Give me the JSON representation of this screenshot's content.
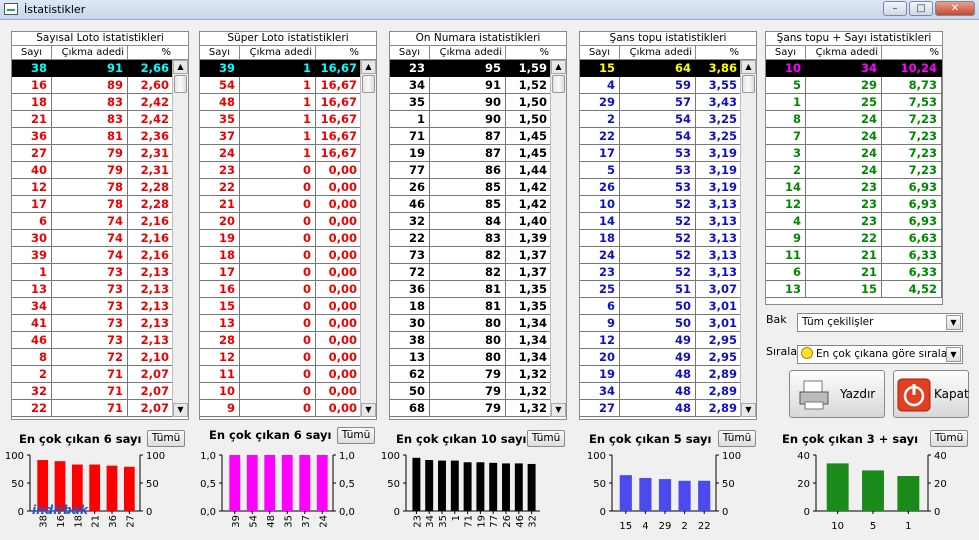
{
  "window": {
    "title": "İstatistikler"
  },
  "panels": [
    {
      "id": "sayisal",
      "title": "Sayısal Loto istatistikleri",
      "headers": [
        "Sayı",
        "Çıkma adedi",
        "%"
      ],
      "text_color": "#ee0000",
      "sel_color": "#00ffff",
      "rows": [
        [
          "38",
          "91",
          "2,66"
        ],
        [
          "16",
          "89",
          "2,60"
        ],
        [
          "18",
          "83",
          "2,42"
        ],
        [
          "21",
          "83",
          "2,42"
        ],
        [
          "36",
          "81",
          "2,36"
        ],
        [
          "27",
          "79",
          "2,31"
        ],
        [
          "40",
          "79",
          "2,31"
        ],
        [
          "12",
          "78",
          "2,28"
        ],
        [
          "17",
          "78",
          "2,28"
        ],
        [
          "6",
          "74",
          "2,16"
        ],
        [
          "30",
          "74",
          "2,16"
        ],
        [
          "39",
          "74",
          "2,16"
        ],
        [
          "1",
          "73",
          "2,13"
        ],
        [
          "13",
          "73",
          "2,13"
        ],
        [
          "34",
          "73",
          "2,13"
        ],
        [
          "41",
          "73",
          "2,13"
        ],
        [
          "46",
          "73",
          "2,13"
        ],
        [
          "8",
          "72",
          "2,10"
        ],
        [
          "2",
          "71",
          "2,07"
        ],
        [
          "32",
          "71",
          "2,07"
        ],
        [
          "22",
          "71",
          "2,07"
        ]
      ]
    },
    {
      "id": "super",
      "title": "Süper Loto istatistikleri",
      "headers": [
        "Sayı",
        "Çıkma adedi",
        "%"
      ],
      "text_color": "#ee0000",
      "sel_color": "#00ffff",
      "rows": [
        [
          "39",
          "1",
          "16,67"
        ],
        [
          "54",
          "1",
          "16,67"
        ],
        [
          "48",
          "1",
          "16,67"
        ],
        [
          "35",
          "1",
          "16,67"
        ],
        [
          "37",
          "1",
          "16,67"
        ],
        [
          "24",
          "1",
          "16,67"
        ],
        [
          "23",
          "0",
          "0,00"
        ],
        [
          "22",
          "0",
          "0,00"
        ],
        [
          "21",
          "0",
          "0,00"
        ],
        [
          "20",
          "0",
          "0,00"
        ],
        [
          "19",
          "0",
          "0,00"
        ],
        [
          "18",
          "0",
          "0,00"
        ],
        [
          "17",
          "0",
          "0,00"
        ],
        [
          "16",
          "0",
          "0,00"
        ],
        [
          "15",
          "0",
          "0,00"
        ],
        [
          "13",
          "0",
          "0,00"
        ],
        [
          "28",
          "0",
          "0,00"
        ],
        [
          "12",
          "0",
          "0,00"
        ],
        [
          "11",
          "0",
          "0,00"
        ],
        [
          "10",
          "0",
          "0,00"
        ],
        [
          "9",
          "0",
          "0,00"
        ]
      ]
    },
    {
      "id": "onnumara",
      "title": "On Numara istatistikleri",
      "headers": [
        "Sayı",
        "Çıkma adedi",
        "%"
      ],
      "text_color": "#000000",
      "sel_color": "#ffffff",
      "rows": [
        [
          "23",
          "95",
          "1,59"
        ],
        [
          "34",
          "91",
          "1,52"
        ],
        [
          "35",
          "90",
          "1,50"
        ],
        [
          "1",
          "90",
          "1,50"
        ],
        [
          "71",
          "87",
          "1,45"
        ],
        [
          "19",
          "87",
          "1,45"
        ],
        [
          "77",
          "86",
          "1,44"
        ],
        [
          "26",
          "85",
          "1,42"
        ],
        [
          "46",
          "85",
          "1,42"
        ],
        [
          "32",
          "84",
          "1,40"
        ],
        [
          "22",
          "83",
          "1,39"
        ],
        [
          "73",
          "82",
          "1,37"
        ],
        [
          "72",
          "82",
          "1,37"
        ],
        [
          "36",
          "81",
          "1,35"
        ],
        [
          "18",
          "81",
          "1,35"
        ],
        [
          "30",
          "80",
          "1,34"
        ],
        [
          "38",
          "80",
          "1,34"
        ],
        [
          "13",
          "80",
          "1,34"
        ],
        [
          "62",
          "79",
          "1,32"
        ],
        [
          "50",
          "79",
          "1,32"
        ],
        [
          "68",
          "79",
          "1,32"
        ]
      ]
    },
    {
      "id": "sanstopu",
      "title": "Şans topu istatistikleri",
      "headers": [
        "Sayı",
        "Çıkma adedi",
        "%"
      ],
      "text_color": "#1010cc",
      "sel_color": "#ffff00",
      "rows": [
        [
          "15",
          "64",
          "3,86"
        ],
        [
          "4",
          "59",
          "3,55"
        ],
        [
          "29",
          "57",
          "3,43"
        ],
        [
          "2",
          "54",
          "3,25"
        ],
        [
          "22",
          "54",
          "3,25"
        ],
        [
          "17",
          "53",
          "3,19"
        ],
        [
          "5",
          "53",
          "3,19"
        ],
        [
          "26",
          "53",
          "3,19"
        ],
        [
          "10",
          "52",
          "3,13"
        ],
        [
          "14",
          "52",
          "3,13"
        ],
        [
          "18",
          "52",
          "3,13"
        ],
        [
          "24",
          "52",
          "3,13"
        ],
        [
          "23",
          "52",
          "3,13"
        ],
        [
          "25",
          "51",
          "3,07"
        ],
        [
          "6",
          "50",
          "3,01"
        ],
        [
          "9",
          "50",
          "3,01"
        ],
        [
          "12",
          "49",
          "2,95"
        ],
        [
          "20",
          "49",
          "2,95"
        ],
        [
          "19",
          "48",
          "2,89"
        ],
        [
          "34",
          "48",
          "2,89"
        ],
        [
          "27",
          "48",
          "2,89"
        ]
      ]
    },
    {
      "id": "sansplus",
      "title": "Şans topu + Sayı istatistikleri",
      "headers": [
        "Sayı",
        "Çıkma adedi",
        "%"
      ],
      "text_color": "#008800",
      "sel_color": "#ff00ff",
      "rows": [
        [
          "10",
          "34",
          "10,24"
        ],
        [
          "5",
          "29",
          "8,73"
        ],
        [
          "1",
          "25",
          "7,53"
        ],
        [
          "8",
          "24",
          "7,23"
        ],
        [
          "7",
          "24",
          "7,23"
        ],
        [
          "3",
          "24",
          "7,23"
        ],
        [
          "2",
          "24",
          "7,23"
        ],
        [
          "14",
          "23",
          "6,93"
        ],
        [
          "12",
          "23",
          "6,93"
        ],
        [
          "4",
          "23",
          "6,93"
        ],
        [
          "9",
          "22",
          "6,63"
        ],
        [
          "11",
          "21",
          "6,33"
        ],
        [
          "6",
          "21",
          "6,33"
        ],
        [
          "13",
          "15",
          "4,52"
        ]
      ]
    }
  ],
  "controls": {
    "bak_label": "Bak",
    "bak_value": "Tüm çekilişler",
    "sirala_label": "Sırala",
    "sirala_value": "En çok çıkana göre sırala",
    "yazdir_label": "Yazdır",
    "kapat_label": "Kapat"
  },
  "charts_ui": [
    {
      "title": "En çok çıkan 6 sayı",
      "button": "Tümü"
    },
    {
      "title": "En çok çıkan 6 sayı",
      "button": "Tümü"
    },
    {
      "title": "En çok çıkan 10 sayı",
      "button": "Tümü"
    },
    {
      "title": "En çok çıkan 5 sayı",
      "button": "Tümü"
    },
    {
      "title": "En çok çıkan 3 + sayı",
      "button": "Tümü"
    }
  ],
  "watermark": "indirbak",
  "chart_data": [
    {
      "type": "bar",
      "color": "#ff0000",
      "categories": [
        "38",
        "16",
        "18",
        "21",
        "36",
        "27"
      ],
      "values": [
        91,
        89,
        83,
        83,
        81,
        79
      ],
      "ylim": [
        0,
        100
      ],
      "yticks": [
        "0",
        "50",
        "100"
      ]
    },
    {
      "type": "bar",
      "color": "#ff00ff",
      "categories": [
        "39",
        "54",
        "48",
        "35",
        "37",
        "24"
      ],
      "values": [
        1,
        1,
        1,
        1,
        1,
        1
      ],
      "ylim": [
        0,
        1
      ],
      "yticks": [
        "0,0",
        "0,5",
        "1,0"
      ]
    },
    {
      "type": "bar",
      "color": "#000000",
      "categories": [
        "23",
        "34",
        "35",
        "1",
        "71",
        "19",
        "77",
        "26",
        "46",
        "32"
      ],
      "values": [
        95,
        91,
        90,
        90,
        87,
        87,
        86,
        85,
        85,
        84
      ],
      "ylim": [
        0,
        100
      ],
      "yticks": [
        "0",
        "50",
        "100"
      ]
    },
    {
      "type": "bar",
      "color": "#4a4aee",
      "categories": [
        "15",
        "4",
        "29",
        "2",
        "22"
      ],
      "values": [
        64,
        59,
        57,
        54,
        54
      ],
      "ylim": [
        0,
        100
      ],
      "yticks": [
        "0",
        "50",
        "100"
      ]
    },
    {
      "type": "bar",
      "color": "#1a8a1a",
      "categories": [
        "10",
        "5",
        "1"
      ],
      "values": [
        34,
        29,
        25
      ],
      "ylim": [
        0,
        40
      ],
      "yticks": [
        "0",
        "20",
        "40"
      ]
    }
  ]
}
